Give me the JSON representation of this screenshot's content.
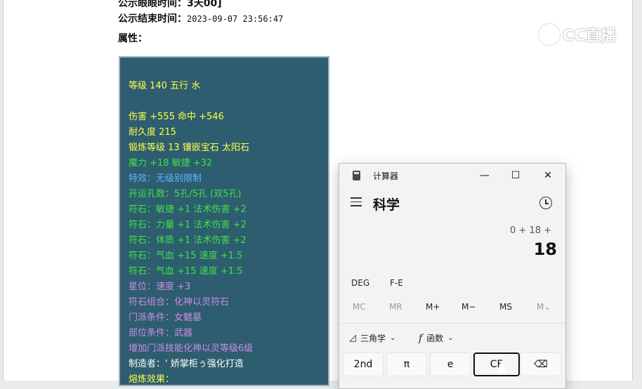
{
  "page": {
    "top_partial": "公示眼眼时间：3天00]",
    "end_label": "公示结束时间：",
    "end_value": "2023-09-07 23:56:47",
    "attr_label": "属性："
  },
  "item_lines": [
    {
      "text": "等级 140 五行 水",
      "color": "#ffff4d"
    },
    {
      "text": "伤害 +555 命中 +546",
      "color": "#ffff4d"
    },
    {
      "text": "耐久度 215",
      "color": "#ffff4d"
    },
    {
      "text": "锻炼等级 13 镶嵌宝石 太阳石",
      "color": "#ffff4d"
    },
    {
      "text": "魔力 +18 敏捷 +32",
      "color": "#3ee04a"
    },
    {
      "text": "特效：无级别限制",
      "color": "#5fb4ff"
    },
    {
      "text": "开运孔数：5孔/5孔 (双5孔)",
      "color": "#3ee04a"
    },
    {
      "text": "符石：敏捷 +1 法术伤害 +2",
      "color": "#3ee04a"
    },
    {
      "text": "符石：力量 +1 法术伤害 +2",
      "color": "#3ee04a"
    },
    {
      "text": "符石：体质 +1 法术伤害 +2",
      "color": "#3ee04a"
    },
    {
      "text": "符石：气血 +15 速度 +1.5",
      "color": "#3ee04a"
    },
    {
      "text": "符石：气血 +15 速度 +1.5",
      "color": "#3ee04a"
    },
    {
      "text": "星位：速度 +3",
      "color": "#c98de8"
    },
    {
      "text": "符石组合：化神以灵符石",
      "color": "#c98de8"
    },
    {
      "text": "门派条件：女魃墓",
      "color": "#c98de8"
    },
    {
      "text": "部位条件：武器",
      "color": "#c98de8"
    },
    {
      "text": "增加门派技能化神以灵等级6级",
      "color": "#c98de8"
    },
    {
      "text": "制造者：' 娇掌柜ぅ强化打造",
      "color": "#ffffff"
    },
    {
      "text": "熔炼效果：",
      "color": "#ffff4d"
    }
  ],
  "watermark": {
    "text": "CC直播"
  },
  "calculator": {
    "title": "计算器",
    "mode": "科学",
    "expression": "0 + 18 +",
    "result": "18",
    "angle_mode": "DEG",
    "fe_label": "F-E",
    "memory": [
      "MC",
      "MR",
      "M+",
      "M−",
      "MS",
      "M⌄"
    ],
    "trig_label": "三角学",
    "func_label": "函数",
    "keys": [
      "2nd",
      "π",
      "e",
      "CE",
      "⌫"
    ],
    "window_buttons": {
      "minimize": "—",
      "maximize": "☐",
      "close": "✕"
    }
  }
}
